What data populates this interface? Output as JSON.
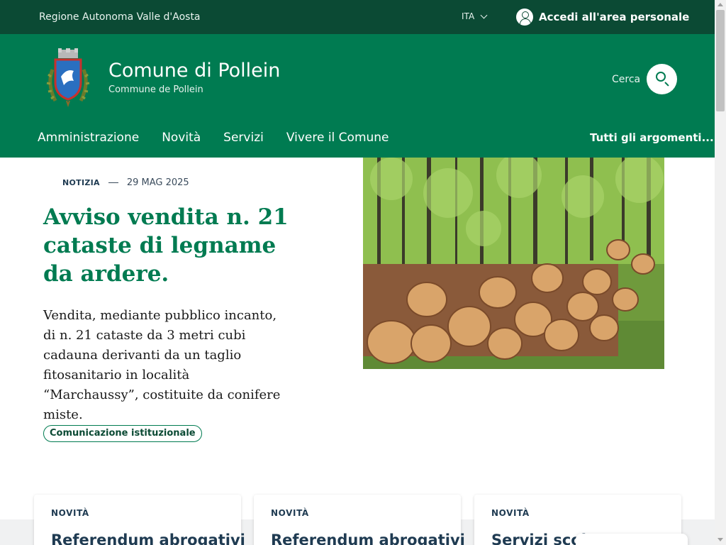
{
  "topbar": {
    "region": "Regione Autonoma Valle d'Aosta",
    "language": "ITA",
    "login_label": "Accedi all'area personale"
  },
  "header": {
    "title": "Comune di Pollein",
    "subtitle": "Commune de Pollein",
    "search_label": "Cerca",
    "nav": [
      "Amministrazione",
      "Novità",
      "Servizi",
      "Vivere il Comune"
    ],
    "all_topics": "Tutti gli argomenti..."
  },
  "hero": {
    "category": "NOTIZIA",
    "date": "29 MAG 2025",
    "title": "Avviso vendita n. 21 cataste di legname da ardere.",
    "description": "Vendita, mediante pubblico incanto, di n. 21 cataste da 3 metri cubi cadauna derivanti da un taglio fitosanitario in località “Marchaussy”, costituite da conifere miste.",
    "tag": "Comunicazione istituzionale"
  },
  "cards": [
    {
      "label": "NOVITÀ",
      "title": "Referendum abrogativi"
    },
    {
      "label": "NOVITÀ",
      "title": "Referendum abrogativi"
    },
    {
      "label": "NOVITÀ",
      "title": "Servizi scola"
    }
  ]
}
